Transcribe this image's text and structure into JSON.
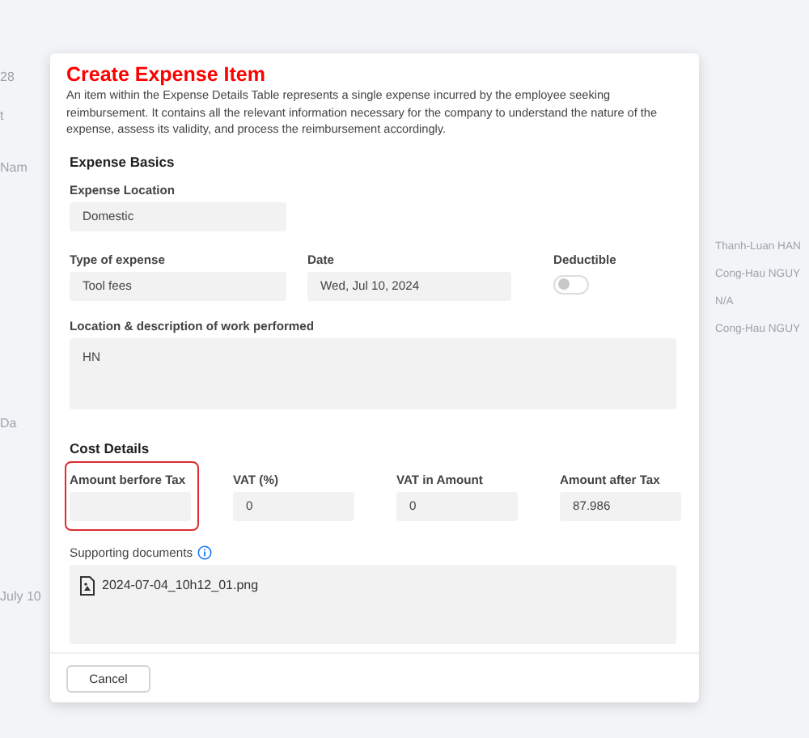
{
  "background": {
    "left_texts": [
      "28",
      "t",
      "Nam",
      "Da",
      "July 10"
    ],
    "right_texts": [
      "Thanh-Luan HAN",
      "Cong-Hau NGUY",
      "N/A",
      "Cong-Hau NGUY"
    ]
  },
  "dialog": {
    "title": "Create Expense Item",
    "description": "An item within the Expense Details Table represents a single expense incurred by the employee seeking reimbursement. It contains all the relevant information necessary for the company to understand the nature of the expense, assess its validity, and process the reimbursement accordingly.",
    "basics": {
      "heading": "Expense Basics",
      "location": {
        "label": "Expense Location",
        "value": "Domestic"
      },
      "type": {
        "label": "Type of expense",
        "value": "Tool fees"
      },
      "date": {
        "label": "Date",
        "value": "Wed, Jul 10, 2024"
      },
      "deductible": {
        "label": "Deductible",
        "on": false
      },
      "description": {
        "label": "Location & description of work performed",
        "value": "HN"
      }
    },
    "cost": {
      "heading": "Cost Details",
      "fields": [
        {
          "label": "Amount berfore Tax",
          "highlighted": true
        },
        {
          "label": "VAT (%)",
          "value": "0",
          "highlighted": false
        },
        {
          "label": "VAT in Amount",
          "value": "0",
          "highlighted": false
        },
        {
          "label": "Amount after Tax",
          "value": "87.986",
          "highlighted": false
        }
      ]
    },
    "documents": {
      "label": "Supporting documents",
      "files": [
        "2024-07-04_10h12_01.png"
      ]
    },
    "buttons": [
      "Cancel"
    ]
  }
}
